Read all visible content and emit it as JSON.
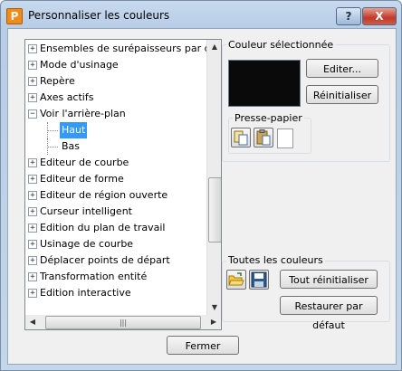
{
  "window": {
    "title": "Personnaliser les couleurs",
    "icon_letter": "P"
  },
  "titlebar": {
    "help_glyph": "?",
    "close_glyph": "X"
  },
  "tree": {
    "items": [
      {
        "label": "Ensembles de surépaisseurs par d",
        "expander": "+"
      },
      {
        "label": "Mode d'usinage",
        "expander": "+"
      },
      {
        "label": "Repère",
        "expander": "+"
      },
      {
        "label": "Axes actifs",
        "expander": "+"
      },
      {
        "label": "Voir l'arrière-plan",
        "expander": "−"
      },
      {
        "label": "Haut",
        "child": true,
        "selected": true
      },
      {
        "label": "Bas",
        "child": true
      },
      {
        "label": "Editeur de courbe",
        "expander": "+"
      },
      {
        "label": "Editeur de forme",
        "expander": "+"
      },
      {
        "label": "Editeur de région ouverte",
        "expander": "+"
      },
      {
        "label": "Curseur intelligent",
        "expander": "+"
      },
      {
        "label": "Edition du plan de travail",
        "expander": "+"
      },
      {
        "label": "Usinage de courbe",
        "expander": "+"
      },
      {
        "label": "Déplacer points de départ",
        "expander": "+"
      },
      {
        "label": "Transformation entité",
        "expander": "+"
      },
      {
        "label": "Edition interactive",
        "expander": "+"
      }
    ],
    "scroll_up": "▲",
    "scroll_down": "▼",
    "scroll_left": "◀",
    "scroll_right": "▶",
    "grip": "|||"
  },
  "selected_color": {
    "group_title": "Couleur sélectionnée",
    "swatch_color": "#0a0a0a",
    "edit_label": "Editer...",
    "reset_label": "Réinitialiser"
  },
  "clipboard": {
    "group_title": "Presse-papier"
  },
  "all_colors": {
    "group_title": "Toutes les couleurs",
    "reset_all_label": "Tout réinitialiser",
    "restore_default_label": "Restaurer par défaut"
  },
  "footer": {
    "close_label": "Fermer"
  }
}
